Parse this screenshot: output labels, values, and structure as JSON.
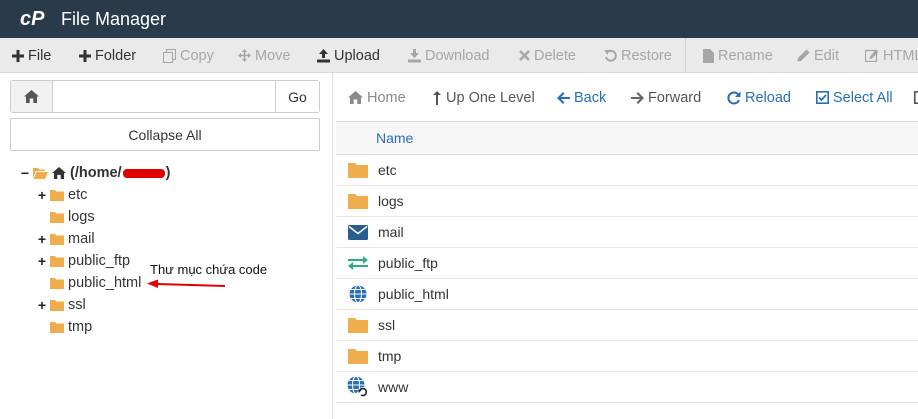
{
  "header": {
    "title": "File Manager"
  },
  "toolbar": {
    "file": "File",
    "folder": "Folder",
    "copy": "Copy",
    "move": "Move",
    "upload": "Upload",
    "download": "Download",
    "delete": "Delete",
    "restore": "Restore",
    "rename": "Rename",
    "edit": "Edit",
    "html": "HTML"
  },
  "search": {
    "value": "",
    "go_label": "Go"
  },
  "collapse_label": "Collapse All",
  "tree": {
    "root_prefix": "(/home/",
    "root_suffix": ")",
    "items": [
      {
        "label": "etc",
        "expandable": true
      },
      {
        "label": "logs",
        "expandable": false
      },
      {
        "label": "mail",
        "expandable": true
      },
      {
        "label": "public_ftp",
        "expandable": true
      },
      {
        "label": "public_html",
        "expandable": false
      },
      {
        "label": "ssl",
        "expandable": true
      },
      {
        "label": "tmp",
        "expandable": false
      }
    ]
  },
  "annotation": "Thư mục chứa code",
  "nav": {
    "home": "Home",
    "up": "Up One Level",
    "back": "Back",
    "forward": "Forward",
    "reload": "Reload",
    "select_all": "Select All"
  },
  "table": {
    "header_name": "Name",
    "rows": [
      {
        "name": "etc",
        "icon": "folder-icon"
      },
      {
        "name": "logs",
        "icon": "folder-icon"
      },
      {
        "name": "mail",
        "icon": "envelope-icon"
      },
      {
        "name": "public_ftp",
        "icon": "transfer-arrows-icon"
      },
      {
        "name": "public_html",
        "icon": "globe-icon"
      },
      {
        "name": "ssl",
        "icon": "folder-icon"
      },
      {
        "name": "tmp",
        "icon": "folder-icon"
      },
      {
        "name": "www",
        "icon": "globe-link-icon"
      }
    ]
  },
  "colors": {
    "header_bg": "#293a4a",
    "link": "#2a6eb6",
    "folder": "#f0ad4e",
    "annotation_arrow": "#e10000"
  }
}
